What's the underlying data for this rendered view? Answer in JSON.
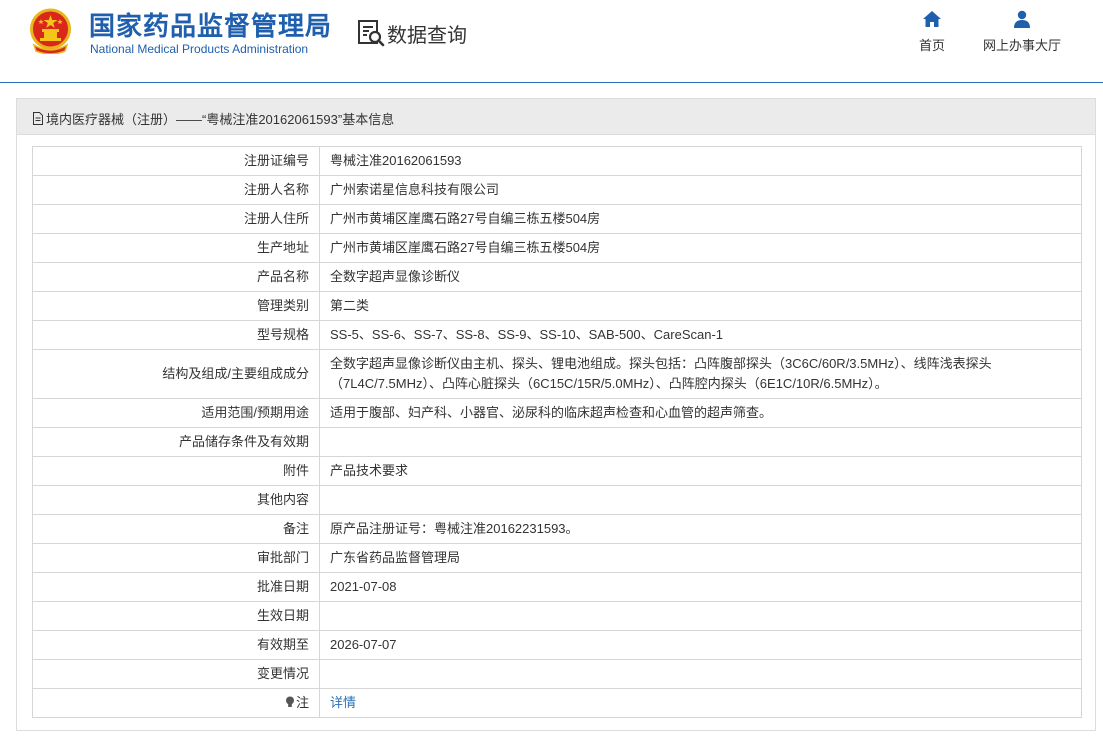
{
  "header": {
    "site_name_cn": "国家药品监督管理局",
    "site_name_en": "National Medical Products Administration",
    "page_title": "数据查询",
    "nav": [
      {
        "label": "首页",
        "icon": "home-icon"
      },
      {
        "label": "网上办事大厅",
        "icon": "user-icon"
      }
    ]
  },
  "panel": {
    "title": "境内医疗器械（注册）——“粤械注准20162061593”基本信息"
  },
  "rows": [
    {
      "label": "注册证编号",
      "value": "粤械注准20162061593"
    },
    {
      "label": "注册人名称",
      "value": "广州索诺星信息科技有限公司"
    },
    {
      "label": "注册人住所",
      "value": "广州市黄埔区崖鹰石路27号自编三栋五楼504房"
    },
    {
      "label": "生产地址",
      "value": "广州市黄埔区崖鹰石路27号自编三栋五楼504房"
    },
    {
      "label": "产品名称",
      "value": "全数字超声显像诊断仪"
    },
    {
      "label": "管理类别",
      "value": "第二类"
    },
    {
      "label": "型号规格",
      "value": "SS-5、SS-6、SS-7、SS-8、SS-9、SS-10、SAB-500、CareScan-1"
    },
    {
      "label": "结构及组成/主要组成成分",
      "value": "全数字超声显像诊断仪由主机、探头、锂电池组成。探头包括：凸阵腹部探头（3C6C/60R/3.5MHz）、线阵浅表探头（7L4C/7.5MHz）、凸阵心脏探头（6C15C/15R/5.0MHz）、凸阵腔内探头（6E1C/10R/6.5MHz）。"
    },
    {
      "label": "适用范围/预期用途",
      "value": "适用于腹部、妇产科、小器官、泌尿科的临床超声检查和心血管的超声筛查。"
    },
    {
      "label": "产品储存条件及有效期",
      "value": ""
    },
    {
      "label": "附件",
      "value": "产品技术要求"
    },
    {
      "label": "其他内容",
      "value": ""
    },
    {
      "label": "备注",
      "value": "原产品注册证号：粤械注准20162231593。"
    },
    {
      "label": "审批部门",
      "value": "广东省药品监督管理局"
    },
    {
      "label": "批准日期",
      "value": "2021-07-08"
    },
    {
      "label": "生效日期",
      "value": ""
    },
    {
      "label": "有效期至",
      "value": "2026-07-07"
    },
    {
      "label": "变更情况",
      "value": ""
    }
  ],
  "note_row": {
    "label": "注",
    "link_text": "详情"
  },
  "colors": {
    "brand_blue": "#1f5fae",
    "link_blue": "#2a6fb9",
    "panel_header_bg": "#ebebeb"
  }
}
